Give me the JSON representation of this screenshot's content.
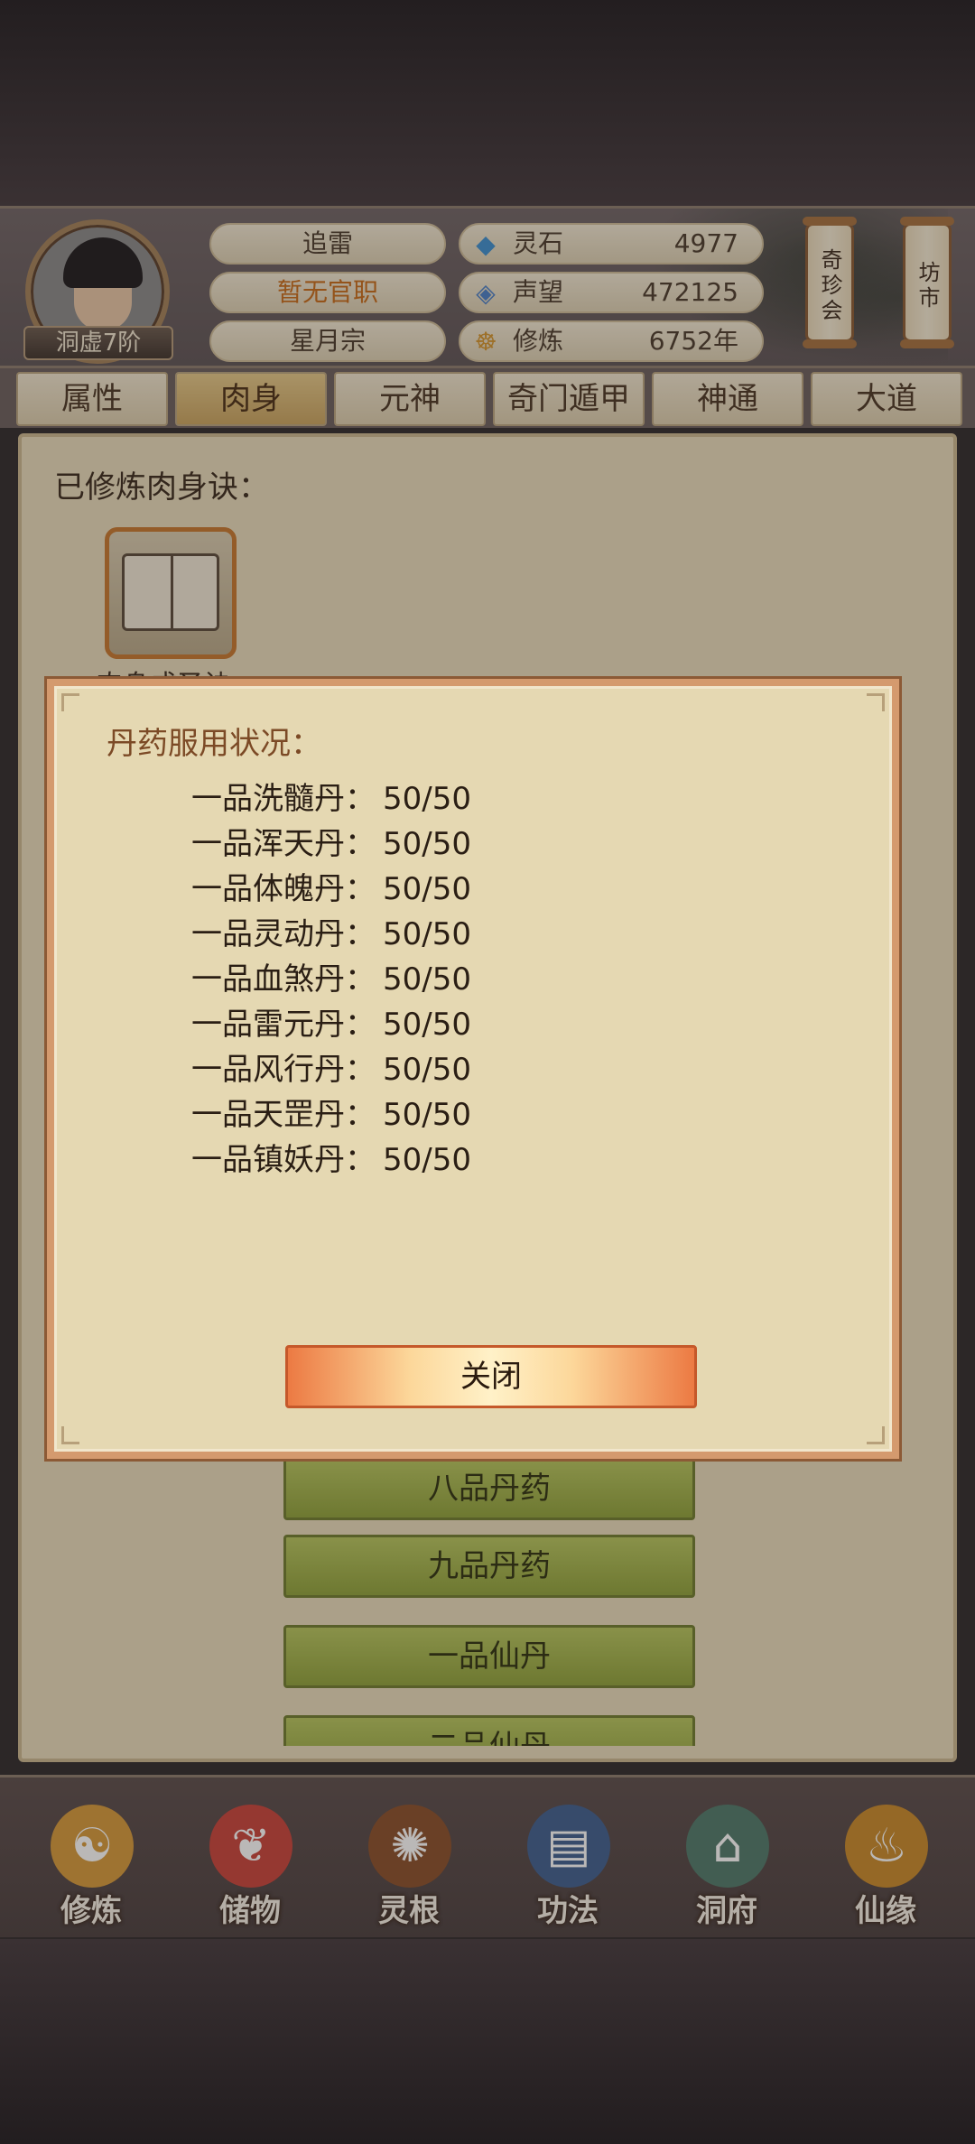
{
  "player": {
    "rank": "洞虚7阶",
    "name": "追雷",
    "title": "暂无官职",
    "sect": "星月宗"
  },
  "stats": [
    {
      "icon": "spirit-stone-icon",
      "label": "灵石",
      "value": "4977"
    },
    {
      "icon": "reputation-icon",
      "label": "声望",
      "value": "472125"
    },
    {
      "icon": "cultivation-icon",
      "label": "修炼",
      "value": "6752年"
    }
  ],
  "side_buttons": {
    "treasure": "奇珍会",
    "market": "坊市"
  },
  "tabs": [
    "属性",
    "肉身",
    "元神",
    "奇门遁甲",
    "神通",
    "大道"
  ],
  "active_tab": "肉身",
  "panel": {
    "label": "已修炼肉身诀：",
    "book_caption": "肉身成圣诀",
    "buttons": [
      "八品丹药",
      "九品丹药",
      "一品仙丹",
      "二品仙丹"
    ]
  },
  "modal": {
    "title": "丹药服用状况：",
    "rows": [
      {
        "name": "一品洗髓丹：",
        "count": "50/50"
      },
      {
        "name": "一品浑天丹：",
        "count": "50/50"
      },
      {
        "name": "一品体魄丹：",
        "count": "50/50"
      },
      {
        "name": "一品灵动丹：",
        "count": "50/50"
      },
      {
        "name": "一品血煞丹：",
        "count": "50/50"
      },
      {
        "name": "一品雷元丹：",
        "count": "50/50"
      },
      {
        "name": "一品风行丹：",
        "count": "50/50"
      },
      {
        "name": "一品天罡丹：",
        "count": "50/50"
      },
      {
        "name": "一品镇妖丹：",
        "count": "50/50"
      }
    ],
    "close_label": "关闭"
  },
  "nav": [
    {
      "label": "修炼",
      "icon": "meditating-monk-icon",
      "color": "#d69a3a"
    },
    {
      "label": "储物",
      "icon": "treasure-bag-icon",
      "color": "#c9433a"
    },
    {
      "label": "灵根",
      "icon": "spirit-root-disc-icon",
      "color": "#8a4f2a"
    },
    {
      "label": "功法",
      "icon": "scripture-book-icon",
      "color": "#3f5f8f"
    },
    {
      "label": "洞府",
      "icon": "cave-dwelling-icon",
      "color": "#4f7a6a"
    },
    {
      "label": "仙缘",
      "icon": "gourd-icon",
      "color": "#c98a2a"
    }
  ]
}
